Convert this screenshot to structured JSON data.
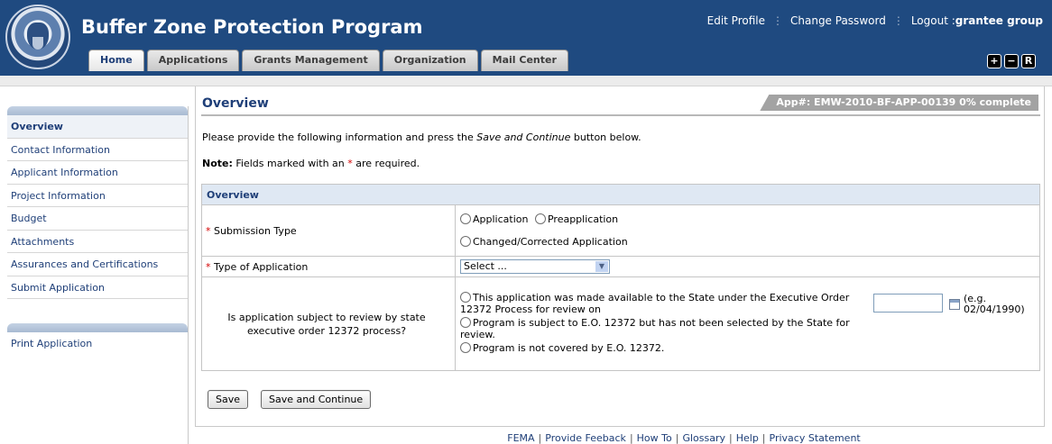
{
  "header": {
    "app_title": "Buffer Zone Protection Program",
    "links": {
      "edit_profile": "Edit Profile",
      "change_password": "Change Password",
      "logout_prefix": "Logout :",
      "logout_user": "grantee group"
    },
    "tabs": [
      "Home",
      "Applications",
      "Grants Management",
      "Organization",
      "Mail Center"
    ],
    "active_tab": "Home",
    "font_controls": {
      "increase": "+",
      "decrease": "−",
      "reset": "R"
    },
    "seal_alt": "U.S. DEPARTMENT OF HOMELAND SECURITY"
  },
  "sidebar": {
    "items": [
      "Overview",
      "Contact Information",
      "Applicant Information",
      "Project Information",
      "Budget",
      "Attachments",
      "Assurances and Certifications",
      "Submit Application"
    ],
    "active": "Overview",
    "secondary_items": [
      "Print Application"
    ]
  },
  "main": {
    "title": "Overview",
    "status": "App#: EMW-2010-BF-APP-00139 0% complete",
    "intro_before": "Please provide the following information and press the ",
    "intro_italic": "Save and Continue",
    "intro_after": " button below.",
    "note_label": "Note:",
    "note_before": " Fields marked with an ",
    "note_star": "*",
    "note_after": " are required."
  },
  "form": {
    "section_title": "Overview",
    "submission_type": {
      "required": "*",
      "label": "Submission Type",
      "options": [
        "Application",
        "Preapplication",
        "Changed/Corrected Application"
      ]
    },
    "type_of_application": {
      "required": "*",
      "label": "Type of Application",
      "selected": "Select ...",
      "arrow": "▼"
    },
    "eo_review": {
      "label": "Is application subject to review by state executive order 12372 process?",
      "options": [
        "This application was made available to the State under the Executive Order 12372 Process for review on",
        "Program is subject to E.O. 12372 but has not been selected by the State for review.",
        "Program is not covered by E.O. 12372."
      ],
      "date_value": "",
      "date_hint_line1": "(e.g.",
      "date_hint_line2": "02/04/1990)"
    }
  },
  "buttons": {
    "save": "Save",
    "save_continue": "Save and Continue"
  },
  "footer": {
    "links": [
      "FEMA",
      "Provide Feeback",
      "How To",
      "Glossary",
      "Help",
      "Privacy Statement"
    ],
    "separator": "|"
  }
}
